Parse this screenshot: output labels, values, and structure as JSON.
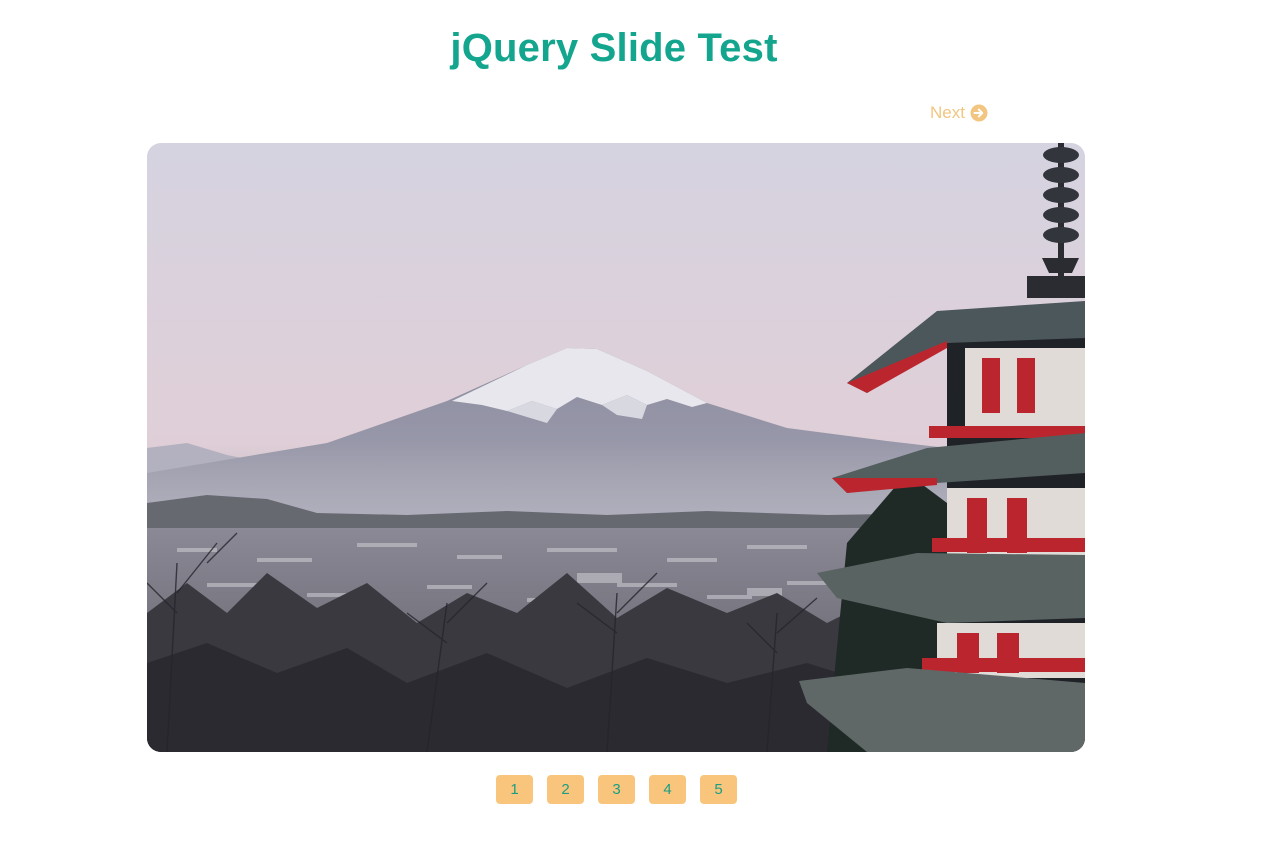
{
  "header": {
    "title": "jQuery Slide Test"
  },
  "controls": {
    "next_label": "Next",
    "next_icon": "arrow-circle-right-icon"
  },
  "slide": {
    "current_index": 1,
    "scene": "Mount Fuji with pagoda at dusk"
  },
  "pager": {
    "pages": [
      "1",
      "2",
      "3",
      "4",
      "5"
    ]
  },
  "colors": {
    "title": "#13a58e",
    "next": "#f2c680",
    "pager_bg": "#f9c57c",
    "pager_text": "#1a9e83"
  }
}
